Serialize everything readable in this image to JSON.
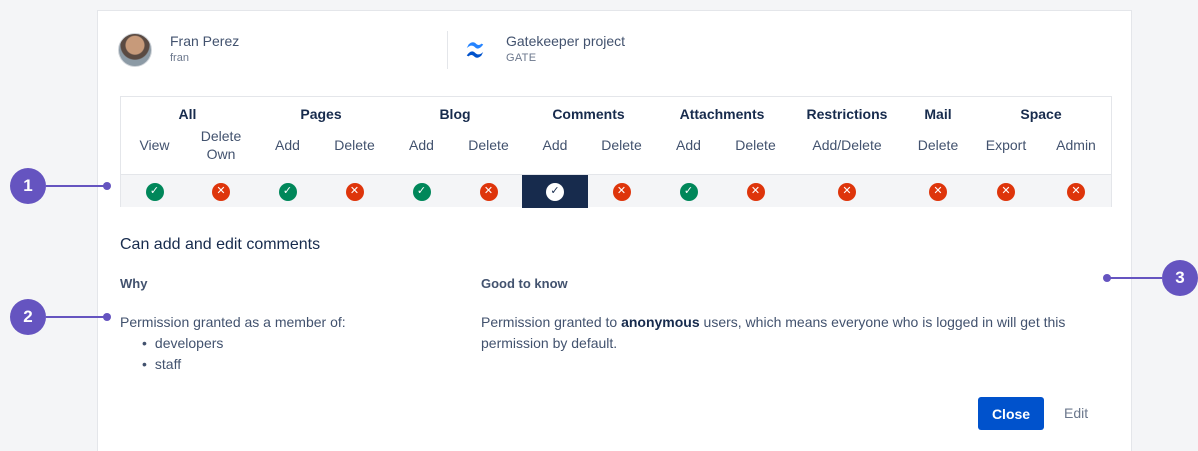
{
  "user": {
    "name": "Fran Perez",
    "handle": "fran"
  },
  "project": {
    "name": "Gatekeeper project",
    "key": "GATE",
    "icon": "confluence-icon"
  },
  "groups": [
    "All",
    "Pages",
    "Blog",
    "Comments",
    "Attachments",
    "Restrictions",
    "Mail",
    "Space"
  ],
  "permissions": [
    {
      "label": "View",
      "status": "granted",
      "selected": false
    },
    {
      "label": "Delete Own",
      "status": "denied",
      "selected": false
    },
    {
      "label": "Add",
      "status": "granted",
      "selected": false
    },
    {
      "label": "Delete",
      "status": "denied",
      "selected": false
    },
    {
      "label": "Add",
      "status": "granted",
      "selected": false
    },
    {
      "label": "Delete",
      "status": "denied",
      "selected": false
    },
    {
      "label": "Add",
      "status": "granted",
      "selected": true
    },
    {
      "label": "Delete",
      "status": "denied",
      "selected": false
    },
    {
      "label": "Add",
      "status": "granted",
      "selected": false
    },
    {
      "label": "Delete",
      "status": "denied",
      "selected": false
    },
    {
      "label": "Add/Delete",
      "status": "denied",
      "selected": false
    },
    {
      "label": "Delete",
      "status": "denied",
      "selected": false
    },
    {
      "label": "Export",
      "status": "denied",
      "selected": false
    },
    {
      "label": "Admin",
      "status": "denied",
      "selected": false
    }
  ],
  "details": {
    "heading": "Can add and edit comments",
    "why_label": "Why",
    "why_text": "Permission granted as a member of:",
    "why_items": [
      "developers",
      "staff"
    ],
    "good_label": "Good to know",
    "good_prefix": "Permission granted to ",
    "good_bold": "anonymous",
    "good_suffix": " users, which means everyone who is logged in will get this permission by default."
  },
  "actions": {
    "close": "Close",
    "edit": "Edit"
  },
  "callouts": [
    "1",
    "2",
    "3"
  ],
  "colors": {
    "granted": "#00875a",
    "denied": "#de350b",
    "selected": "#172b4d",
    "primary": "#0052cc",
    "callout": "#6554c0"
  }
}
